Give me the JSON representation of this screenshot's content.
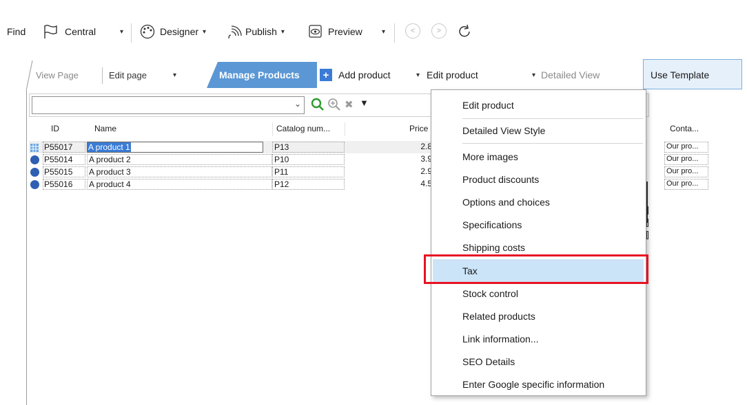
{
  "toolbar": {
    "find": "Find",
    "central": "Central",
    "designer": "Designer",
    "publish": "Publish",
    "preview": "Preview"
  },
  "ribbon": {
    "view_page": "View Page",
    "edit_page": "Edit page",
    "manage_products": "Manage Products",
    "add_product": "Add product",
    "edit_product": "Edit product",
    "detailed_view": "Detailed View",
    "use_template": "Use Template"
  },
  "grid": {
    "search_value": "",
    "columns": [
      "ID",
      "Name",
      "Catalog num...",
      "Price",
      "Conta..."
    ],
    "rows": [
      {
        "id": "P55017",
        "name": "A product 1",
        "catalog": "P13",
        "price": "2.8",
        "contact": "Our pro..."
      },
      {
        "id": "P55014",
        "name": "A product 2",
        "catalog": "P10",
        "price": "3.9",
        "contact": "Our pro..."
      },
      {
        "id": "P55015",
        "name": "A product 3",
        "catalog": "P11",
        "price": "2.9",
        "contact": "Our pro..."
      },
      {
        "id": "P55016",
        "name": "A product 4",
        "catalog": "P12",
        "price": "4.5",
        "contact": "Our pro..."
      }
    ]
  },
  "menu": {
    "items": [
      "Edit product",
      "Detailed View Style",
      "More images",
      "Product discounts",
      "Options and choices",
      "Specifications",
      "Shipping costs",
      "Tax",
      "Stock control",
      "Related products",
      "Link information...",
      "SEO Details",
      "Enter Google specific information"
    ],
    "highlighted": "Tax"
  },
  "colors": {
    "accent_tab": "#5b97d4",
    "menu_highlight": "#cce4f7",
    "highlight_box": "#e81123",
    "selection": "#3a7bd5"
  }
}
